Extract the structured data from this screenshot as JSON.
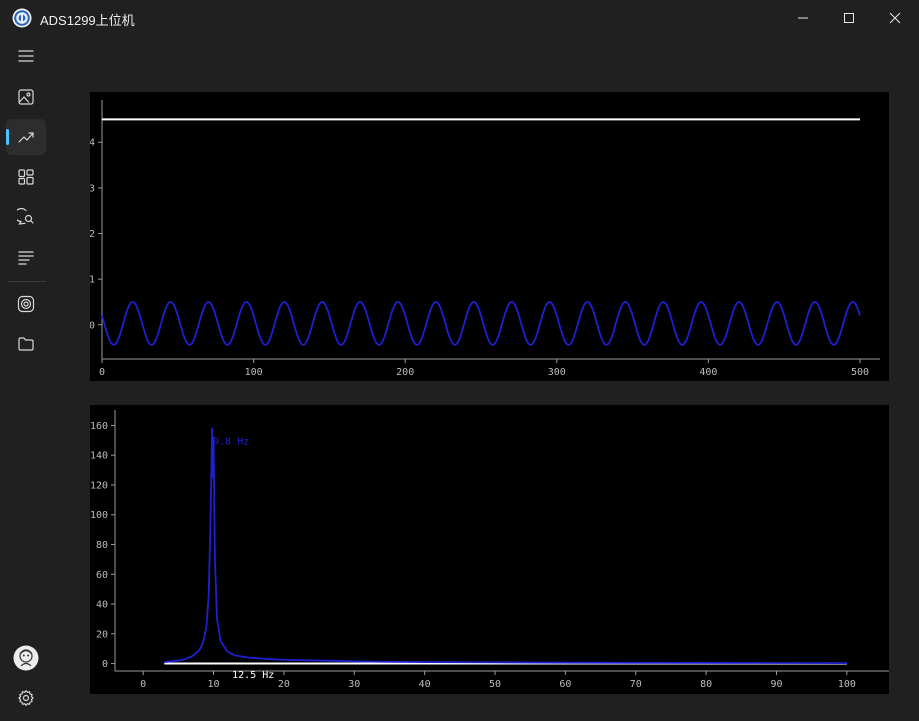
{
  "window": {
    "title": "ADS1299上位机",
    "controls": {
      "minimize": "minimize",
      "maximize": "maximize",
      "close": "close"
    }
  },
  "sidebar": {
    "items": [
      {
        "id": "menu",
        "icon": "hamburger-menu-icon",
        "active": false
      },
      {
        "id": "image",
        "icon": "image-icon",
        "active": false
      },
      {
        "id": "chart",
        "icon": "trending-chart-icon",
        "active": true
      },
      {
        "id": "apps",
        "icon": "apps-grid-icon",
        "active": false
      },
      {
        "id": "chat",
        "icon": "chat-search-icon",
        "active": false
      },
      {
        "id": "list",
        "icon": "text-lines-icon",
        "active": false
      },
      {
        "id": "record",
        "icon": "radio-target-icon",
        "active": false
      },
      {
        "id": "folder",
        "icon": "folder-icon",
        "active": false
      },
      {
        "id": "avatar",
        "icon": "avatar-icon",
        "active": false
      },
      {
        "id": "settings",
        "icon": "gear-icon",
        "active": false
      }
    ],
    "accent": "#4cc2ff"
  },
  "chart_data": [
    {
      "type": "line",
      "xlim": [
        0,
        500
      ],
      "ylim": [
        -0.75,
        4.75
      ],
      "xticks": [
        0,
        100,
        200,
        300,
        400,
        500
      ],
      "yticks": [
        0,
        1,
        2,
        3,
        4
      ],
      "grid": false,
      "series": [
        {
          "color": "#ffffff",
          "x": [
            0,
            500
          ],
          "y": [
            4.5,
            4.5
          ]
        },
        {
          "color": "#1f1fd0",
          "waveform": "sine",
          "x_range": [
            0,
            500
          ],
          "amplitude": 0.47,
          "offset": 0.03,
          "period": 25
        }
      ]
    },
    {
      "type": "line",
      "xlim": [
        -4,
        104
      ],
      "ylim": [
        -5,
        165
      ],
      "xticks": [
        0,
        10,
        20,
        30,
        40,
        50,
        60,
        70,
        80,
        90,
        100
      ],
      "yticks": [
        0,
        20,
        40,
        60,
        80,
        100,
        120,
        140,
        160
      ],
      "grid": false,
      "annotations": [
        {
          "text": "9.8 Hz",
          "x": 9.8,
          "y": 150,
          "color": "#1f1fd0"
        },
        {
          "text": "12.5 Hz",
          "x": 12.5,
          "y": -7,
          "color": "#ffffff"
        }
      ],
      "series": [
        {
          "color": "#ffffff",
          "x": [
            3,
            100
          ],
          "y": [
            0,
            0
          ]
        },
        {
          "color": "#1f1fd0",
          "x": [
            3,
            5,
            6,
            7,
            8,
            8.5,
            9,
            9.3,
            9.5,
            9.7,
            9.8,
            9.9,
            10.0,
            10.2,
            10.5,
            11,
            12,
            13,
            15,
            18,
            20,
            25,
            30,
            32,
            40,
            50,
            60,
            70,
            100
          ],
          "y": [
            1,
            2,
            3,
            5,
            9,
            14,
            25,
            45,
            80,
            130,
            158,
            125,
            152,
            70,
            30,
            15,
            8,
            5.5,
            4,
            3,
            2.5,
            2,
            1.5,
            1.3,
            1,
            0.8,
            0.6,
            0.5,
            0.3
          ]
        }
      ]
    }
  ]
}
